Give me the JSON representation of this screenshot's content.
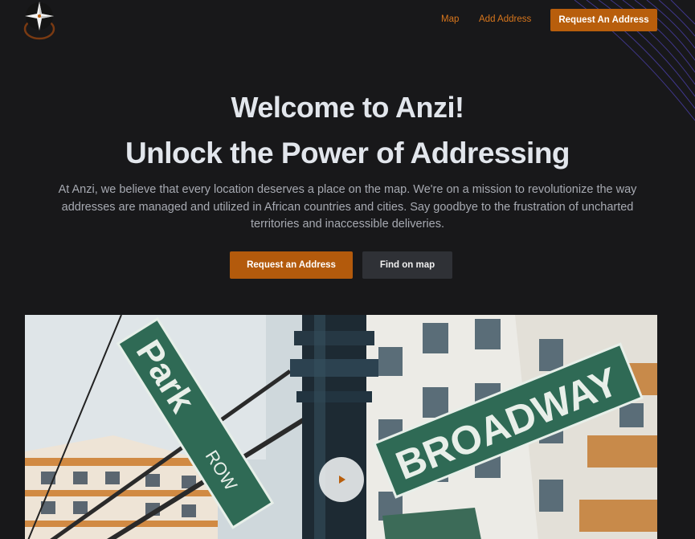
{
  "nav": {
    "logo_icon": "compass-star-icon",
    "map_label": "Map",
    "add_address_label": "Add Address",
    "request_label": "Request An Address"
  },
  "hero": {
    "title_line1": "Welcome to Anzi!",
    "title_line2": "Unlock the Power of Addressing",
    "description": "At Anzi, we believe that every location deserves a place on the map. We're on a mission to revolutionize the way addresses are managed and utilized in African countries and cities. Say goodbye to the frustration of uncharted territories and inaccessible deliveries.",
    "primary_button": "Request an Address",
    "secondary_button": "Find on map"
  },
  "media": {
    "sign_1": "Park",
    "sign_1_sub": "ROW",
    "sign_2": "BROADWAY",
    "play_icon": "play-icon"
  },
  "colors": {
    "background": "#18181a",
    "accent": "#b85e0c",
    "link": "#d8761c",
    "heading": "#e2e6ec",
    "body_text": "#a7aab2",
    "secondary_button": "#2f3136",
    "sign_green": "#2f6a55"
  }
}
